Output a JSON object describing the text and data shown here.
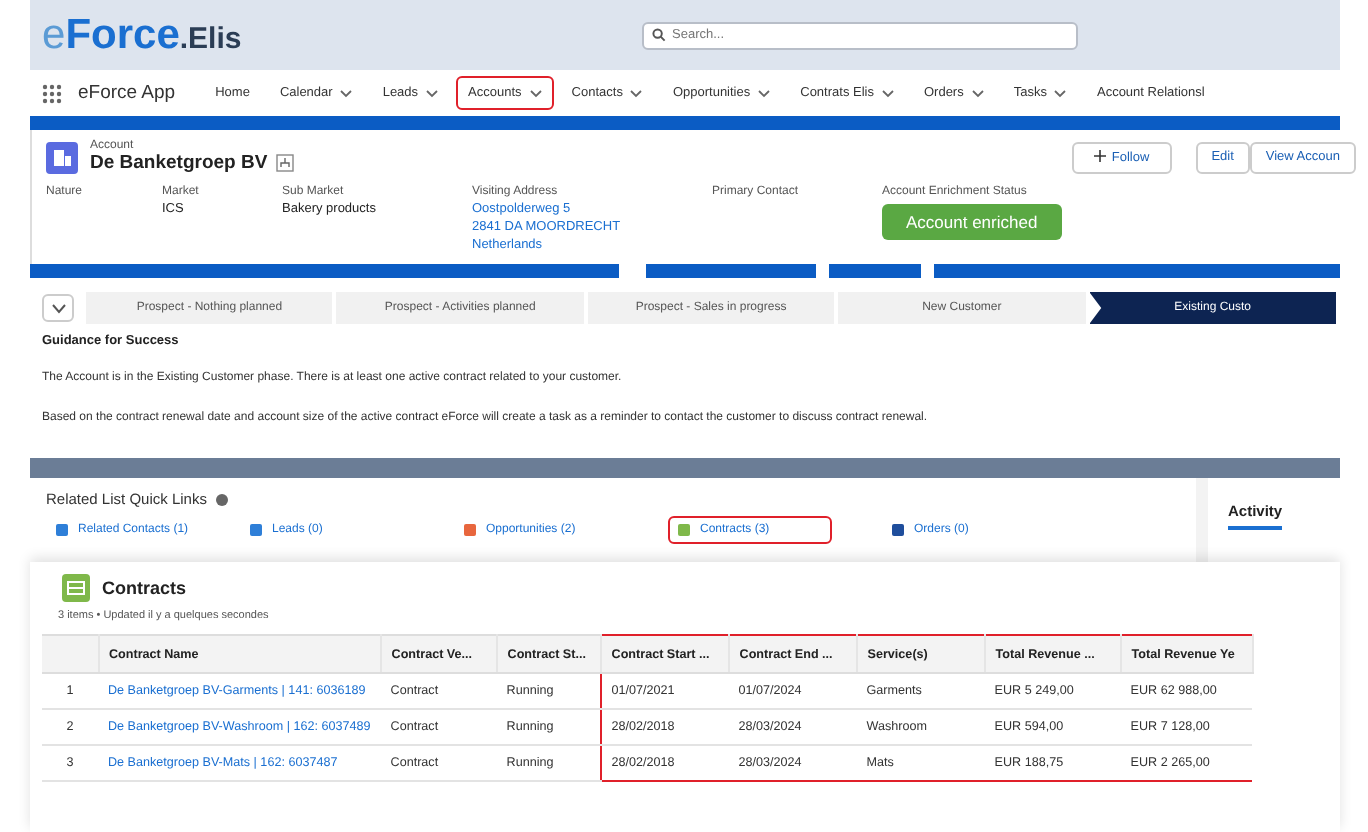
{
  "logo": {
    "prefix": "e",
    "name": "Force",
    "suffix": ".Elis"
  },
  "search": {
    "placeholder": "Search..."
  },
  "nav": {
    "app_name": "eForce App",
    "items": [
      {
        "label": "Home",
        "dropdown": false,
        "highlighted": false
      },
      {
        "label": "Calendar",
        "dropdown": true,
        "highlighted": false
      },
      {
        "label": "Leads",
        "dropdown": true,
        "highlighted": false
      },
      {
        "label": "Accounts",
        "dropdown": true,
        "highlighted": true
      },
      {
        "label": "Contacts",
        "dropdown": true,
        "highlighted": false
      },
      {
        "label": "Opportunities",
        "dropdown": true,
        "highlighted": false
      },
      {
        "label": "Contrats Elis",
        "dropdown": true,
        "highlighted": false
      },
      {
        "label": "Orders",
        "dropdown": true,
        "highlighted": false
      },
      {
        "label": "Tasks",
        "dropdown": true,
        "highlighted": false
      },
      {
        "label": "Account Relationsl",
        "dropdown": false,
        "highlighted": false
      }
    ]
  },
  "account": {
    "type": "Account",
    "name": "De Banketgroep BV",
    "buttons": [
      {
        "label": "Follow",
        "kind": "follow"
      },
      {
        "label": "Edit",
        "kind": "plain"
      },
      {
        "label": "View Accoun",
        "kind": "plain"
      }
    ],
    "fields": [
      {
        "label": "Nature",
        "kind": "text"
      },
      {
        "label": "Market",
        "kind": "text",
        "lines": [
          "ICS"
        ]
      },
      {
        "label": "Sub Market",
        "kind": "text",
        "lines": [
          "Bakery products"
        ]
      },
      {
        "label": "Visiting Address",
        "kind": "link",
        "lines": [
          "Oostpolderweg 5",
          "2841 DA MOORDRECHT",
          "Netherlands"
        ]
      },
      {
        "label": "Primary Contact",
        "kind": "text"
      },
      {
        "label": "Account Enrichment Status",
        "kind": "badge",
        "lines": [
          "Account enriched"
        ]
      }
    ]
  },
  "path": {
    "stages": [
      {
        "label": "Prospect - Nothing planned",
        "selected": false
      },
      {
        "label": "Prospect - Activities planned",
        "selected": false
      },
      {
        "label": "Prospect - Sales in progress",
        "selected": false
      },
      {
        "label": "New Customer",
        "selected": false
      },
      {
        "label": "Existing Custo",
        "selected": true
      }
    ]
  },
  "guidance": {
    "title": "Guidance for Success",
    "paragraphs": [
      "The Account is in the Existing Customer phase. There is at least one active contract related to your customer.",
      "Based on the contract renewal date and account size of the active contract eForce will create a task as a reminder to contact the customer to discuss contract renewal."
    ]
  },
  "quick_links": {
    "title": "Related List Quick Links",
    "items": [
      {
        "label": "Related Contacts (1)",
        "color": "#2e7fd8",
        "highlighted": false
      },
      {
        "label": "Leads (0)",
        "color": "#2e7fd8",
        "highlighted": false
      },
      {
        "label": "Opportunities (2)",
        "color": "#e8663d",
        "highlighted": false
      },
      {
        "label": "Contracts (3)",
        "color": "#7fb84a",
        "highlighted": true
      },
      {
        "label": "Orders (0)",
        "color": "#1f4e9c",
        "highlighted": false
      }
    ]
  },
  "side_tabs": [
    {
      "label": "Activity",
      "selected": true
    }
  ],
  "contracts": {
    "title": "Contracts",
    "subtitle": "3 items • Updated il y a quelques secondes",
    "columns": [
      {
        "label": "Contract Name",
        "highlighted": false
      },
      {
        "label": "Contract Ve...",
        "highlighted": false
      },
      {
        "label": "Contract St...",
        "highlighted": false
      },
      {
        "label": "Contract Start ...",
        "highlighted": true
      },
      {
        "label": "Contract End ...",
        "highlighted": true
      },
      {
        "label": "Service(s)",
        "highlighted": true
      },
      {
        "label": "Total Revenue ...",
        "highlighted": true
      },
      {
        "label": "Total Revenue Ye",
        "highlighted": true
      }
    ],
    "rows": [
      {
        "number": "1",
        "cells": [
          "De Banketgroep BV-Garments | 141: 6036189",
          "Contract",
          "Running",
          "01/07/2021",
          "01/07/2024",
          "Garments",
          "EUR 5 249,00",
          "EUR 62 988,00"
        ]
      },
      {
        "number": "2",
        "cells": [
          "De Banketgroep BV-Washroom | 162: 6037489",
          "Contract",
          "Running",
          "28/02/2018",
          "28/03/2024",
          "Washroom",
          "EUR 594,00",
          "EUR 7 128,00"
        ]
      },
      {
        "number": "3",
        "cells": [
          "De Banketgroep BV-Mats | 162: 6037487",
          "Contract",
          "Running",
          "28/02/2018",
          "28/03/2024",
          "Mats",
          "EUR 188,75",
          "EUR 2 265,00"
        ]
      }
    ]
  }
}
